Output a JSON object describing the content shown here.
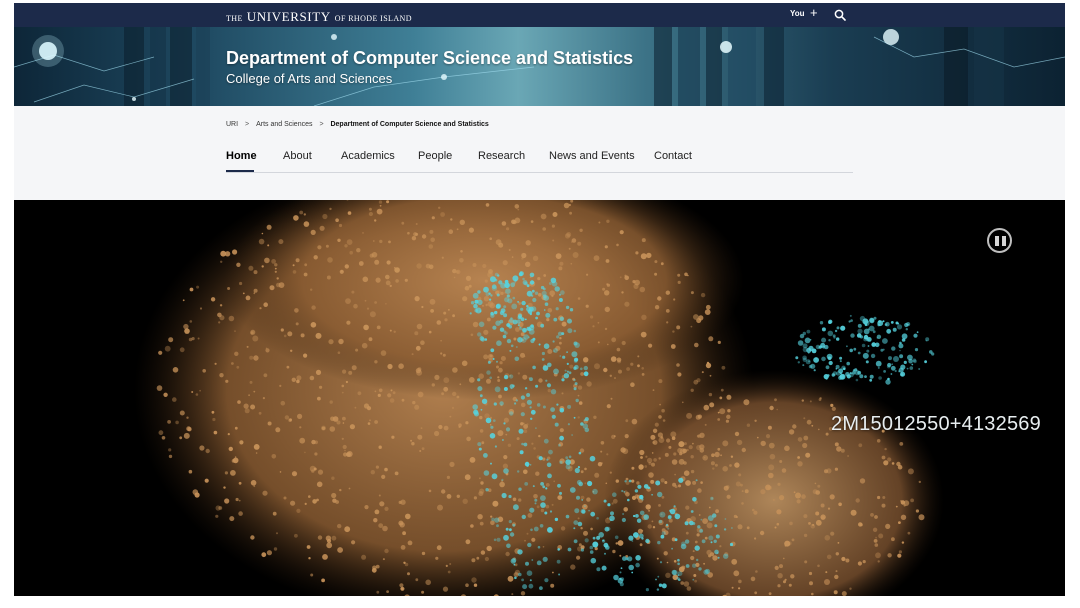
{
  "topbar": {
    "brand_prefix": "THE",
    "brand_main": "UNIVERSITY",
    "brand_suffix": "OF RHODE ISLAND",
    "you_label": "You",
    "plus_glyph": "+",
    "icons": {
      "add": "plus-icon",
      "search": "search-icon"
    },
    "bg_color": "#1c2a4a"
  },
  "banner": {
    "title": "Department of Computer Science and Statistics",
    "subtitle": "College of Arts and Sciences"
  },
  "breadcrumb": {
    "items": [
      "URI",
      "Arts and Sciences",
      "Department of Computer Science and Statistics"
    ],
    "separator": ">"
  },
  "nav": {
    "items": [
      {
        "label": "Home",
        "active": true
      },
      {
        "label": "About",
        "active": false
      },
      {
        "label": "Academics",
        "active": false
      },
      {
        "label": "People",
        "active": false
      },
      {
        "label": "Research",
        "active": false
      },
      {
        "label": "News and Events",
        "active": false
      },
      {
        "label": "Contact",
        "active": false
      }
    ]
  },
  "video": {
    "overlay_text": "2M15012550+4132569",
    "pause_icon": "pause-icon",
    "colors": {
      "warm": "#c8935a",
      "cyan": "#56d4e0"
    }
  }
}
